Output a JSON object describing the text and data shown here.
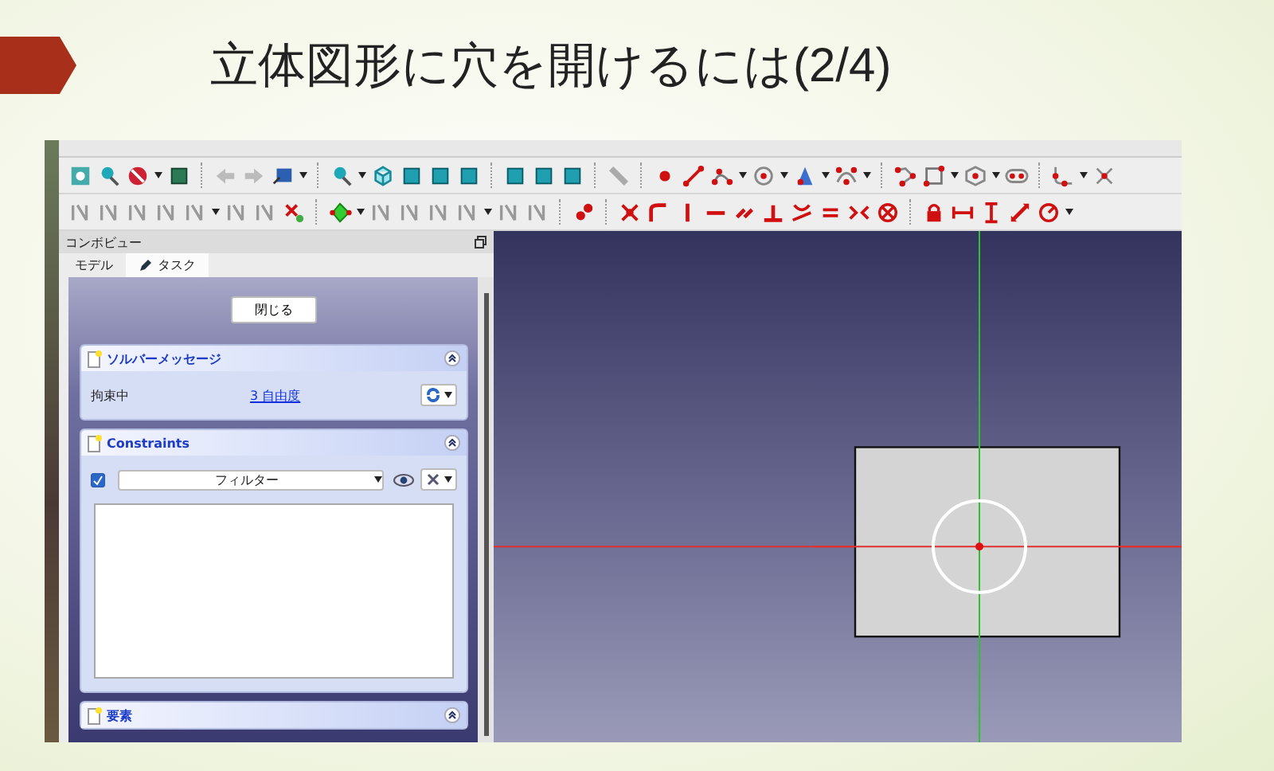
{
  "slide": {
    "title": "立体図形に穴を開けるには(2/4)"
  },
  "combo_view": {
    "title": "コンボビュー",
    "tabs": [
      {
        "label": "モデル",
        "selected": false
      },
      {
        "label": "タスク",
        "selected": true
      }
    ],
    "close_button": "閉じる",
    "panels": [
      {
        "kind": "solver",
        "title": "ソルバーメッセージ",
        "status": "拘束中",
        "link": "3 自由度"
      },
      {
        "kind": "constraints",
        "title": "Constraints",
        "checked": true,
        "filter": "フィルター"
      },
      {
        "kind": "elements",
        "title": "要素"
      }
    ]
  }
}
